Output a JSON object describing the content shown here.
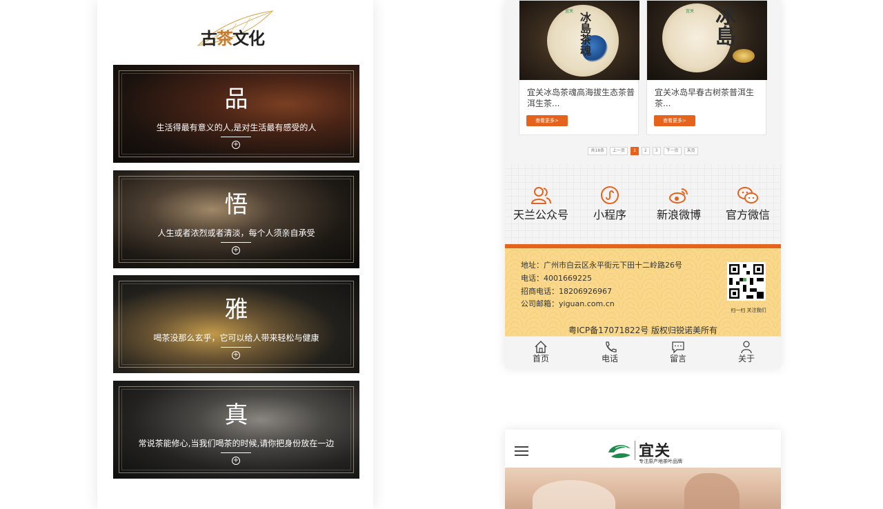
{
  "left_phone": {
    "logo": {
      "part1": "古",
      "accent": "茶",
      "part2": "文化"
    },
    "cards": [
      {
        "title": "品",
        "subtitle": "生活得最有意义的人,是对生活最有感受的人"
      },
      {
        "title": "悟",
        "subtitle": "人生或者浓烈或者清淡，每个人须亲自承受"
      },
      {
        "title": "雅",
        "subtitle": "喝茶没那么玄乎，它可以给人带来轻松与健康"
      },
      {
        "title": "真",
        "subtitle": "常说茶能修心,当我们喝茶的时候,请你把身份放在一边"
      }
    ]
  },
  "right_phone": {
    "products": [
      {
        "name": "宜关冰岛茶魂高海拔生态茶普洱生茶...",
        "button": "查看更多>",
        "image_text": "冰島茶魂",
        "image_badge": "宜关"
      },
      {
        "name": "宜关冰岛早春古树茶普洱生茶...",
        "button": "查看更多>",
        "image_text": "冰島",
        "image_badge": "宜关"
      }
    ],
    "pagination": [
      "共18条",
      "上一页",
      "1",
      "2",
      "3",
      "下一页",
      "末页"
    ],
    "social": [
      {
        "label": "天兰公众号",
        "icon": "users-icon"
      },
      {
        "label": "小程序",
        "icon": "mini-program-icon"
      },
      {
        "label": "新浪微博",
        "icon": "weibo-icon"
      },
      {
        "label": "官方微信",
        "icon": "wechat-icon"
      }
    ],
    "contact": {
      "address": "地址：广州市白云区永平街元下田十二岭路26号",
      "phone": "电话：4001669225",
      "recruit": "招商电话：18206926967",
      "email": "公司邮箱：yiguan.com.cn",
      "qr_caption": "扫一扫 关注我们",
      "icp": "粤ICP备17071822号 版权归锐诺美所有"
    },
    "tabbar": [
      {
        "label": "首页",
        "icon": "home-icon"
      },
      {
        "label": "电话",
        "icon": "phone-icon"
      },
      {
        "label": "留言",
        "icon": "message-icon"
      },
      {
        "label": "关于",
        "icon": "user-icon"
      }
    ],
    "colors": {
      "accent": "#e5631c",
      "footer_bg": "#f9d88b"
    }
  },
  "bottom_phone": {
    "brand_name": "宜关",
    "brand_tagline": "专注原产地茶叶品牌",
    "brand_color": "#1e8a4c"
  }
}
